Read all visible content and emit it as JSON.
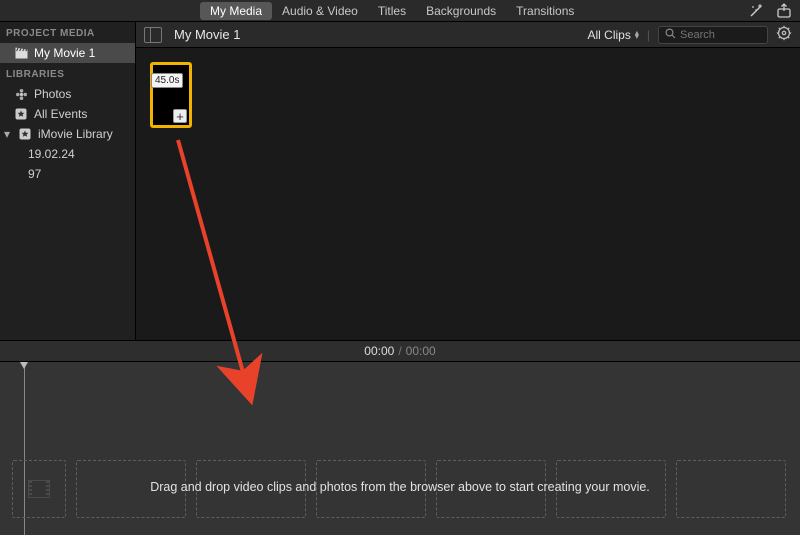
{
  "tabs": {
    "my_media": "My Media",
    "audio_video": "Audio & Video",
    "titles": "Titles",
    "backgrounds": "Backgrounds",
    "transitions": "Transitions"
  },
  "sidebar": {
    "section_project": "PROJECT MEDIA",
    "project_name": "My Movie 1",
    "section_libraries": "LIBRARIES",
    "photos": "Photos",
    "all_events": "All Events",
    "library": "iMovie Library",
    "date_item": "19.02.24",
    "num_item": "97"
  },
  "browser": {
    "title": "My Movie 1",
    "filter_label": "All Clips",
    "search_placeholder": "Search",
    "clip_duration": "45.0s",
    "clip_plus": "+"
  },
  "timeline": {
    "current": "00:00",
    "sep": "/",
    "total": "00:00",
    "hint": "Drag and drop video clips and photos from the browser above to start creating your movie."
  }
}
